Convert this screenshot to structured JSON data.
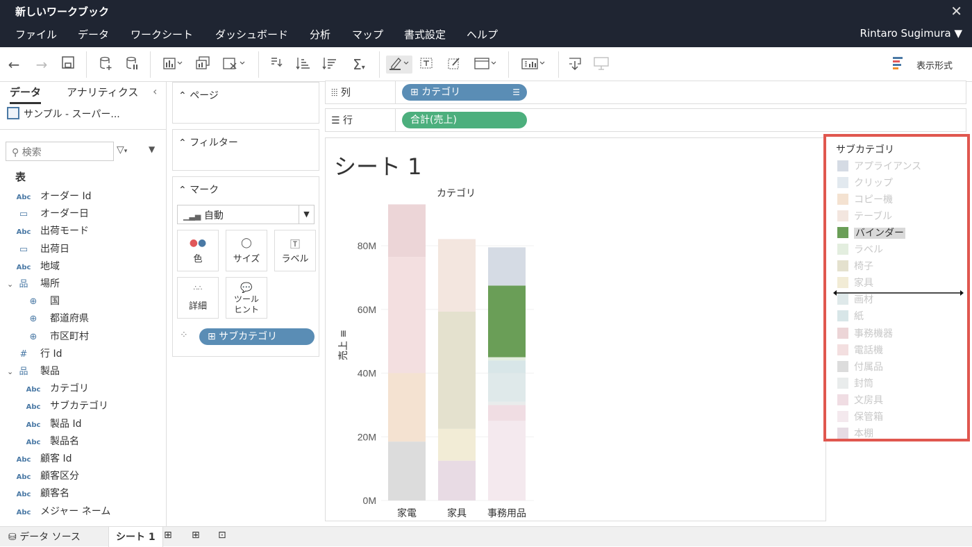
{
  "window": {
    "title": "新しいワークブック",
    "close_icon": "close-icon"
  },
  "menu": {
    "items": [
      "ファイル",
      "データ",
      "ワークシート",
      "ダッシュボード",
      "分析",
      "マップ",
      "書式設定",
      "ヘルプ"
    ],
    "user": "Rintaro Sugimura ▼"
  },
  "toolbar": {
    "show_me_label": "表示形式"
  },
  "data_pane": {
    "tab_data": "データ",
    "tab_analytics": "アナリティクス",
    "datasource": "サンプル - スーパー...",
    "search_placeholder": "検索",
    "section": "表",
    "fields": [
      {
        "type": "Abc",
        "label": "オーダー Id"
      },
      {
        "type": "date",
        "label": "オーダー日"
      },
      {
        "type": "Abc",
        "label": "出荷モード"
      },
      {
        "type": "date",
        "label": "出荷日"
      },
      {
        "type": "Abc",
        "label": "地域"
      },
      {
        "type": "hier",
        "label": "場所"
      },
      {
        "type": "geo",
        "label": "国"
      },
      {
        "type": "geo",
        "label": "都道府県"
      },
      {
        "type": "geo",
        "label": "市区町村"
      },
      {
        "type": "num",
        "label": "行 Id"
      },
      {
        "type": "hier",
        "label": "製品"
      },
      {
        "type": "Abc",
        "label": "カテゴリ"
      },
      {
        "type": "Abc",
        "label": "サブカテゴリ"
      },
      {
        "type": "Abc",
        "label": "製品 Id"
      },
      {
        "type": "Abc",
        "label": "製品名"
      },
      {
        "type": "Abc",
        "label": "顧客 Id"
      },
      {
        "type": "Abc",
        "label": "顧客区分"
      },
      {
        "type": "Abc",
        "label": "顧客名"
      },
      {
        "type": "Abc",
        "label": "メジャー ネーム"
      }
    ]
  },
  "cards": {
    "pages": "ページ",
    "filters": "フィルター",
    "marks": "マーク",
    "mark_type": "自動",
    "buttons": {
      "color": "色",
      "size": "サイズ",
      "label": "ラベル",
      "detail": "詳細",
      "tooltip": "ツールヒント"
    },
    "color_pill": "⊞ サブカテゴリ"
  },
  "shelves": {
    "columns_label": "列",
    "columns_pill": "⊞ カテゴリ",
    "rows_label": "行",
    "rows_pill": "合計(売上)"
  },
  "sheet": {
    "title": "シート 1"
  },
  "chart_data": {
    "type": "bar",
    "stacked": true,
    "title": "",
    "column_header": "カテゴリ",
    "xlabel": "",
    "ylabel": "売上",
    "ylim": [
      0,
      92
    ],
    "yticks": [
      "0M",
      "20M",
      "40M",
      "60M",
      "80M"
    ],
    "ytick_values": [
      0,
      20,
      40,
      60,
      80
    ],
    "categories": [
      "家電",
      "家具",
      "事務用品"
    ],
    "series": [
      {
        "name": "付属品",
        "color": "#dcdcdc",
        "values": [
          18.5,
          0,
          0
        ]
      },
      {
        "name": "コピー機",
        "color": "#f4e2d1",
        "values": [
          21.5,
          0,
          0
        ]
      },
      {
        "name": "電話機",
        "color": "#f3dfe0",
        "values": [
          36.5,
          0,
          0
        ]
      },
      {
        "name": "事務機器",
        "color": "#ecd5d7",
        "values": [
          16.5,
          0,
          0
        ]
      },
      {
        "name": "家具",
        "color": "#eee4cf",
        "values": [
          0,
          0,
          0
        ]
      },
      {
        "name": "文房具",
        "color": "#e8dbe4",
        "values": [
          0,
          12.5,
          0
        ]
      },
      {
        "name": "家具",
        "color": "#f2ecd6",
        "values": [
          0,
          10,
          0
        ]
      },
      {
        "name": "椅子",
        "color": "#e4e1ce",
        "values": [
          0,
          36.8,
          0
        ]
      },
      {
        "name": "テーブル",
        "color": "#f3e6df",
        "values": [
          0,
          22.8,
          0
        ]
      },
      {
        "name": "保管箱",
        "color": "#f4e9ee",
        "values": [
          0,
          0,
          25
        ]
      },
      {
        "name": "文房具",
        "color": "#f0dde3",
        "values": [
          0,
          0,
          5
        ]
      },
      {
        "name": "封筒",
        "color": "#e9ecec",
        "values": [
          0,
          0,
          1
        ]
      },
      {
        "name": "画材",
        "color": "#dfe9ea",
        "values": [
          0,
          0,
          9
        ]
      },
      {
        "name": "紙",
        "color": "#d8e6e8",
        "values": [
          0,
          0,
          4
        ]
      },
      {
        "name": "ラベル",
        "color": "#e3eedf",
        "values": [
          0,
          0,
          1
        ]
      },
      {
        "name": "バインダー",
        "color": "#6a9e57",
        "values": [
          0,
          0,
          22.5
        ]
      },
      {
        "name": "アプライアンス",
        "color": "#d5dbe4",
        "values": [
          0,
          0,
          12
        ]
      }
    ]
  },
  "legend": {
    "title": "サブカテゴリ",
    "items": [
      {
        "label": "アプライアンス",
        "color": "#d5dbe4",
        "state": "dim"
      },
      {
        "label": "クリップ",
        "color": "#e2e9ef",
        "state": "dim"
      },
      {
        "label": "コピー機",
        "color": "#f4e2d1",
        "state": "dim"
      },
      {
        "label": "テーブル",
        "color": "#f3e6df",
        "state": "dim"
      },
      {
        "label": "バインダー",
        "color": "#6a9e57",
        "state": "sel"
      },
      {
        "label": "ラベル",
        "color": "#e3eedf",
        "state": "dim"
      },
      {
        "label": "椅子",
        "color": "#e4e1ce",
        "state": "dim"
      },
      {
        "label": "家具",
        "color": "#f2ecd6",
        "state": "dim"
      },
      {
        "label": "画材",
        "color": "#dfe9ea",
        "state": "dim"
      },
      {
        "label": "紙",
        "color": "#d8e6e8",
        "state": "dim"
      },
      {
        "label": "事務機器",
        "color": "#ecd5d7",
        "state": "dim"
      },
      {
        "label": "電話機",
        "color": "#f3dfe0",
        "state": "dim"
      },
      {
        "label": "付属品",
        "color": "#dcdcdc",
        "state": "dim"
      },
      {
        "label": "封筒",
        "color": "#e9ecec",
        "state": "dim"
      },
      {
        "label": "文房具",
        "color": "#f0dde3",
        "state": "dim"
      },
      {
        "label": "保管箱",
        "color": "#f4e9ee",
        "state": "dim"
      },
      {
        "label": "本棚",
        "color": "#e6dbe3",
        "state": "dim"
      }
    ]
  },
  "bottom_tabs": {
    "datasource": "データ ソース",
    "sheet": "シート 1"
  }
}
